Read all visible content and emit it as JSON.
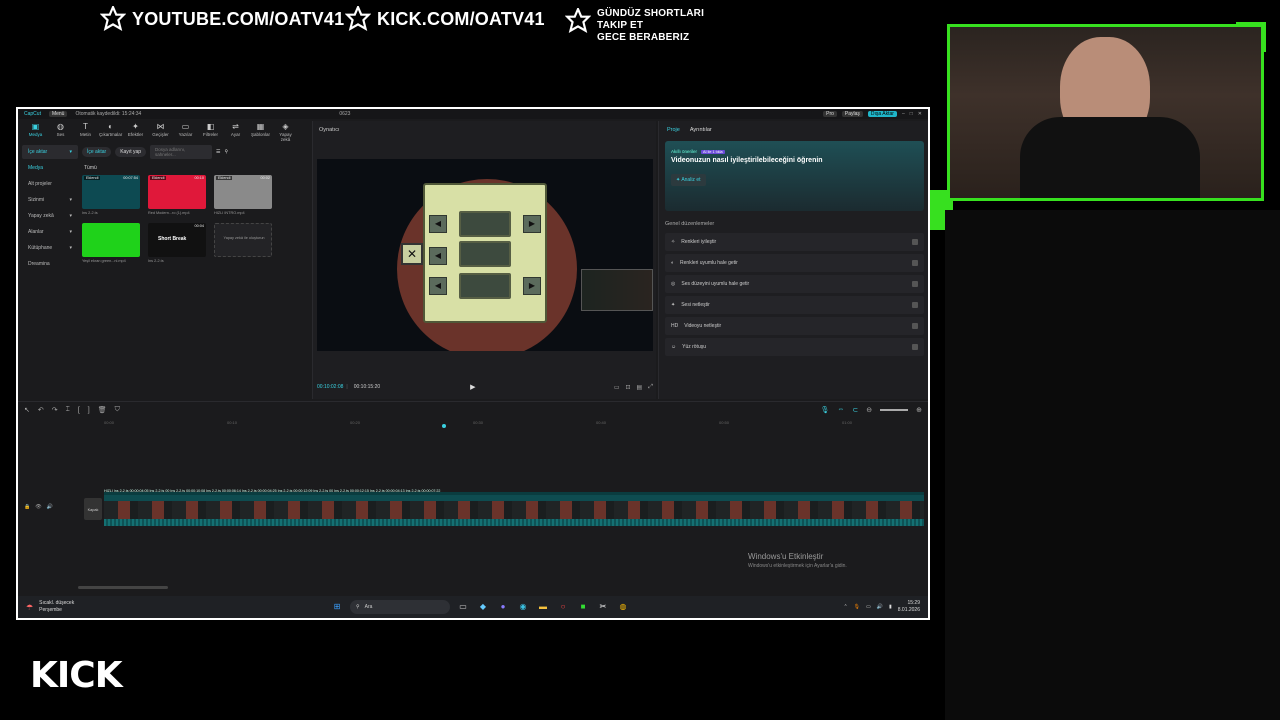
{
  "overlay": {
    "promo1": "YOUTUBE.COM/OATV41",
    "promo2": "KICK.COM/OATV41",
    "promo3_l1": "GÜNDÜZ SHORTLARI",
    "promo3_l2": "TAKIP ET",
    "promo3_l3": "GECE BERABERIZ",
    "kick_logo": "KICK",
    "brand_green": "#37e01f"
  },
  "app": {
    "name": "CapCut",
    "menu": "Menü",
    "autosave": "Otomatik kaydedildi: 15:24:34",
    "project_title": "0623",
    "pro": "Pro",
    "share": "Paylaş",
    "export": "Dışa Aktar",
    "accent": "#3ad1e0"
  },
  "toolbar": {
    "items": [
      "Medya",
      "Ses",
      "Metin",
      "Çıkartmalar",
      "Efektler",
      "Geçişler",
      "Yazılar",
      "Filtreler",
      "Ayar",
      "Şablonlar",
      "Yapay zekâ"
    ]
  },
  "sidebar": {
    "items": [
      "İçe aktar",
      "Medya",
      "Alt projeler",
      "Sizinmi",
      "Yapay zekâ",
      "Alanlar",
      "Kütüphane",
      "Dreamina"
    ]
  },
  "media": {
    "import_btn": "İçe aktar",
    "record_btn": "Kayıt yap",
    "search_placeholder": "Dosya adlarını, sahneler...",
    "all_label": "Tümü",
    "thumbs": [
      {
        "badge": "Eklendi",
        "dur": "00:07:54",
        "label": "Ins 2-2.ts",
        "color": "#0d4a52"
      },
      {
        "badge": "Eklendi",
        "dur": "00:10",
        "label": "Red Modern...ro (1).mp4",
        "color": "#e0183a"
      },
      {
        "badge": "Eklendi",
        "dur": "00:02",
        "label": "HIZLI INTRO.mp4",
        "color": "#8a8a8a"
      },
      {
        "badge": "",
        "dur": "",
        "label": "Yeşil ekran green...ni.mp4",
        "color": "#1fd21a"
      },
      {
        "badge": "",
        "dur": "00:04",
        "label": "Ins 2-2.ts",
        "color": "#111111"
      },
      {
        "badge": "",
        "dur": "",
        "label": "",
        "color": "#232326"
      }
    ],
    "short_break": "Short Break",
    "add_ai": "Yapay zekâ ile oluşturun"
  },
  "player": {
    "title": "Oynatıcı",
    "time_current": "00:10:02:08",
    "time_total": "00:10:15:20"
  },
  "props": {
    "tab_project": "Proje",
    "tab_settings": "Ayrıntılar",
    "ai_small": "Akıllı öneriler",
    "ai_tag": "AI ile 1 tıkla",
    "ai_title": "Videonuzun nasıl iyileştirilebileceğini öğrenin",
    "analyze": "Analiz et",
    "general": "Genel düzenlemeler",
    "options": [
      "Renkleri iyileştir",
      "Renkleri uyumlu hale getir",
      "Ses düzeyini uyumlu hale getir",
      "Sesi netleştir",
      "Videoyu netleştir",
      "Yüz rötuşu"
    ]
  },
  "timeline": {
    "ruler": [
      "00:00",
      "00:10",
      "00:20",
      "00:30",
      "00:40",
      "00:50",
      "01:00"
    ],
    "cover": "Kapak",
    "clip_labels": "HIZLI  Ins 2-2.ts  00:00:04:05  Ins 2-2.ts  00  Ins 2-2.ts  00:00:10:08     Ins 2-2.ts  00:00:06:14     Ins 2-2.ts  00:00:04:25   Ins 2-2.ts  00:00:12:09                    Ins 2-2.ts  00   Ins 2-2.ts  00:00:12:15                              Ins 2-2.ts  00:00:04:13   Ins 2-2.ts  00:00:07:22"
  },
  "watermark": {
    "title": "Windows'u Etkinleştir",
    "sub": "Windows'u etkinleştirmek için Ayarlar'a gidin."
  },
  "taskbar": {
    "weather_l1": "Sıcakl. düşecek",
    "weather_l2": "Perşembe",
    "search": "Ara",
    "time": "15:29",
    "date": "8.01.2026"
  }
}
